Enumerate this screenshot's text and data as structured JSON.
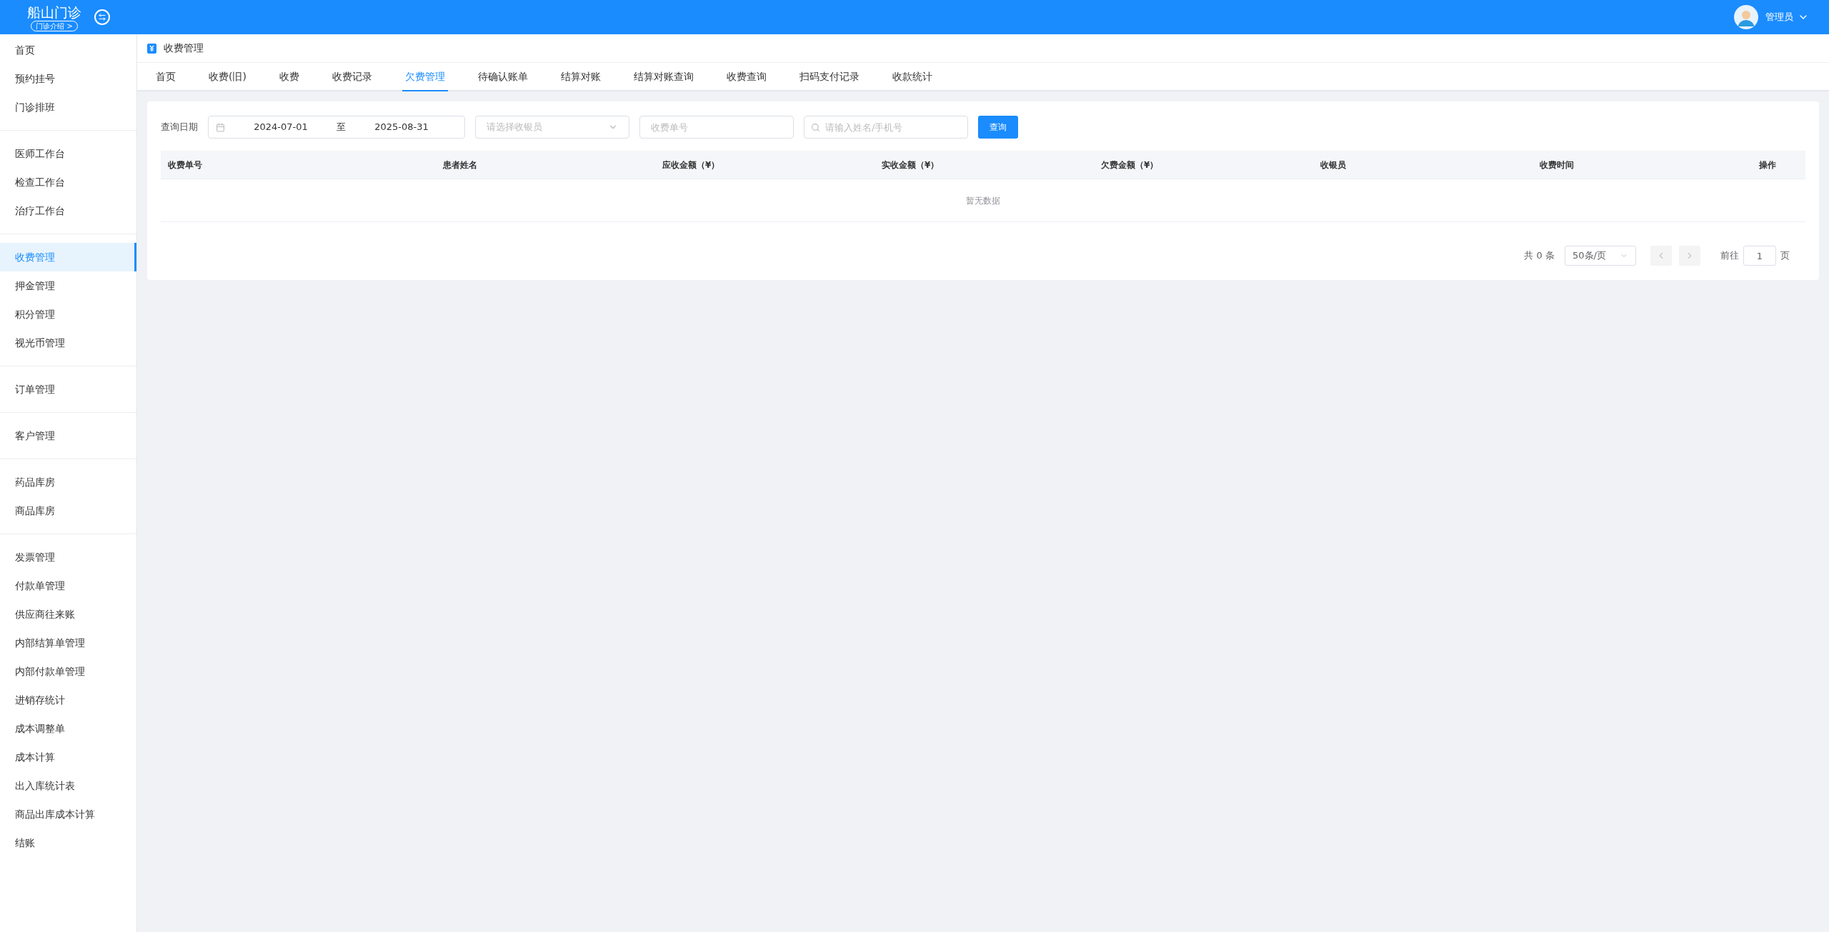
{
  "header": {
    "clinic_name": "船山门诊",
    "clinic_intro_link": "门诊介绍 >",
    "user_name": "管理员"
  },
  "sidebar": {
    "groups": [
      [
        {
          "label": "首页",
          "selected": false
        },
        {
          "label": "预约挂号",
          "selected": false
        },
        {
          "label": "门诊排班",
          "selected": false
        }
      ],
      [
        {
          "label": "医师工作台",
          "selected": false
        },
        {
          "label": "检查工作台",
          "selected": false
        },
        {
          "label": "治疗工作台",
          "selected": false
        }
      ],
      [
        {
          "label": "收费管理",
          "selected": true
        },
        {
          "label": "押金管理",
          "selected": false
        },
        {
          "label": "积分管理",
          "selected": false
        },
        {
          "label": "视光币管理",
          "selected": false
        }
      ],
      [
        {
          "label": "订单管理",
          "selected": false
        }
      ],
      [
        {
          "label": "客户管理",
          "selected": false
        }
      ],
      [
        {
          "label": "药品库房",
          "selected": false
        },
        {
          "label": "商品库房",
          "selected": false
        }
      ],
      [
        {
          "label": "发票管理",
          "selected": false
        },
        {
          "label": "付款单管理",
          "selected": false
        },
        {
          "label": "供应商往来账",
          "selected": false
        },
        {
          "label": "内部结算单管理",
          "selected": false
        },
        {
          "label": "内部付款单管理",
          "selected": false
        },
        {
          "label": "进销存统计",
          "selected": false
        },
        {
          "label": "成本调整单",
          "selected": false
        },
        {
          "label": "成本计算",
          "selected": false
        },
        {
          "label": "出入库统计表",
          "selected": false
        },
        {
          "label": "商品出库成本计算",
          "selected": false
        },
        {
          "label": "结账",
          "selected": false
        }
      ]
    ]
  },
  "breadcrumb": {
    "title": "收费管理"
  },
  "tabs": [
    {
      "label": "首页",
      "selected": false
    },
    {
      "label": "收费(旧)",
      "selected": false
    },
    {
      "label": "收费",
      "selected": false
    },
    {
      "label": "收费记录",
      "selected": false
    },
    {
      "label": "欠费管理",
      "selected": true
    },
    {
      "label": "待确认账单",
      "selected": false
    },
    {
      "label": "结算对账",
      "selected": false
    },
    {
      "label": "结算对账查询",
      "selected": false
    },
    {
      "label": "收费查询",
      "selected": false
    },
    {
      "label": "扫码支付记录",
      "selected": false
    },
    {
      "label": "收款统计",
      "selected": false
    }
  ],
  "filters": {
    "date_label": "查询日期",
    "date_start": "2024-07-01",
    "date_separator": "至",
    "date_end": "2025-08-31",
    "cashier_placeholder": "请选择收银员",
    "receipt_placeholder": "收费单号",
    "search_placeholder": "请输入姓名/手机号",
    "query_button": "查询"
  },
  "table": {
    "columns": [
      "收费单号",
      "患者姓名",
      "应收金额（¥）",
      "实收金额（¥）",
      "欠费金额（¥）",
      "收银员",
      "收费时间",
      "操作"
    ],
    "empty_text": "暂无数据"
  },
  "pagination": {
    "total": "共 0 条",
    "page_size": "50条/页",
    "goto_label": "前往",
    "page": "1",
    "page_suffix": "页"
  }
}
